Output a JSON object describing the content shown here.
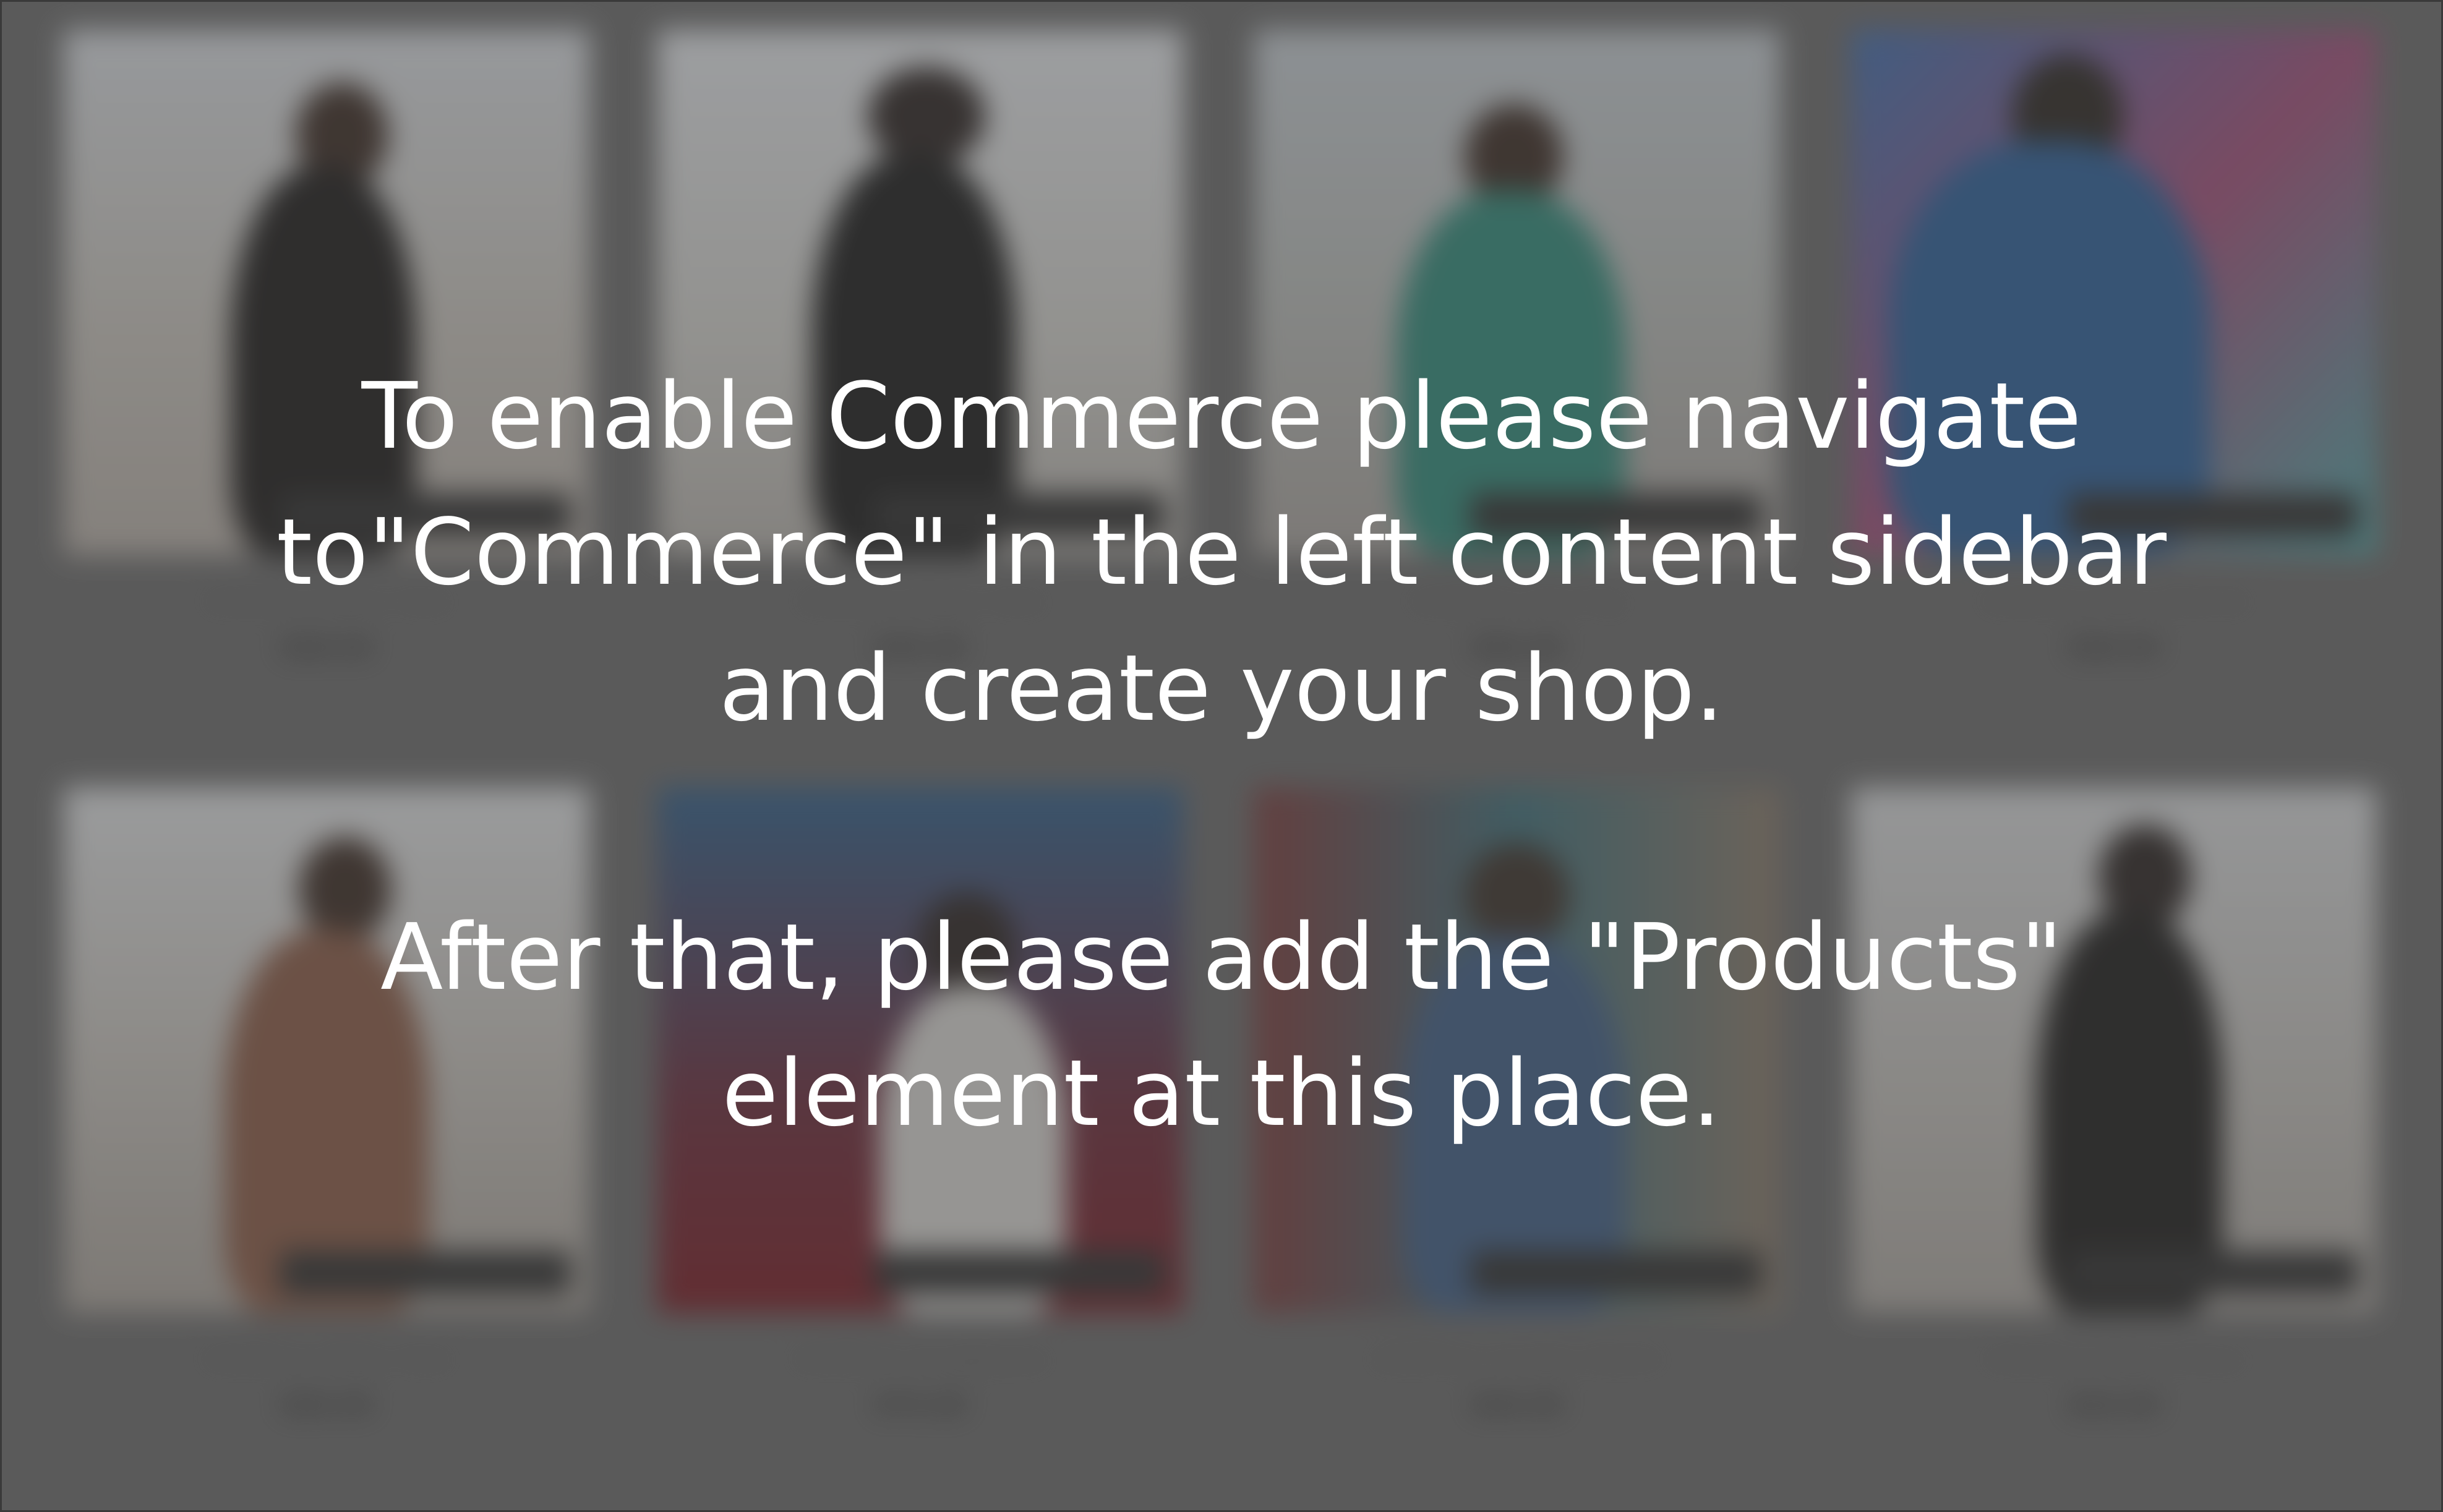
{
  "message": {
    "line1": "To enable Commerce please navigate",
    "line2": "to\"Commerce\" in the left content sidebar",
    "line3": "and create your shop.",
    "line4": "After that, please add the \"Products\"",
    "line5": "element at this place."
  },
  "colors": {
    "overlay": "#5f5f5f",
    "text": "#ffffff"
  },
  "products": [
    {
      "name": "SAMPLE Black Tank",
      "price": "$39.00"
    },
    {
      "name": "SAMPLE Black Tank",
      "price": "$45.00"
    },
    {
      "name": "SAMPLE Teal Top",
      "price": "$35.00"
    },
    {
      "name": "SAMPLE Blue Flannel",
      "price": "$39.00"
    },
    {
      "name": "SAMPLE White Tank",
      "price": "$30.00"
    },
    {
      "name": "SAMPLE Sunglasses",
      "price": "$70.00"
    },
    {
      "name": "SAMPLE Trucker Denim",
      "price": "$40.00"
    },
    {
      "name": "SAMPLE Black Dress",
      "price": "$44.00"
    }
  ]
}
